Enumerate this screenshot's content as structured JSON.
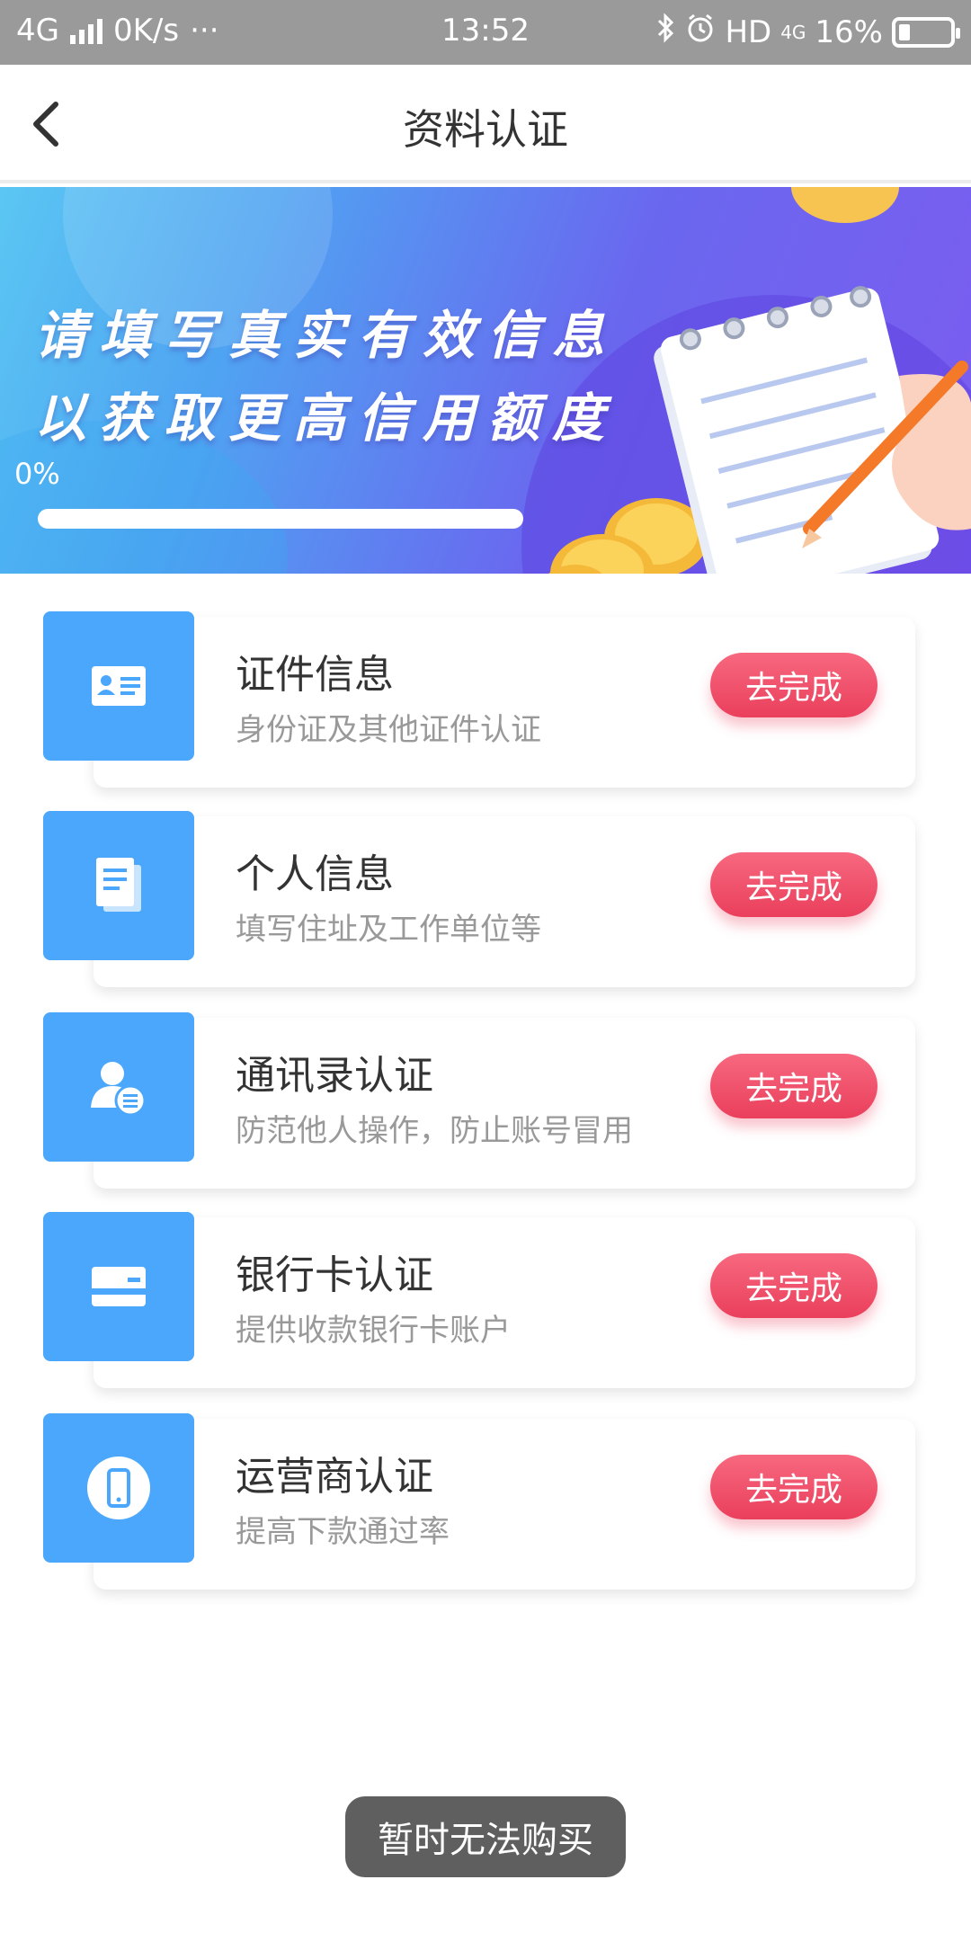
{
  "status_bar": {
    "network": "4G",
    "speed": "0K/s",
    "more": "···",
    "time": "13:52",
    "hd": "HD",
    "net2": "4G",
    "battery": "16%"
  },
  "nav": {
    "title": "资料认证"
  },
  "banner": {
    "line1": "请填写真实有效信息",
    "line2": "以获取更高信用额度",
    "progress_text": "0%",
    "progress": 0
  },
  "items": [
    {
      "title": "证件信息",
      "subtitle": "身份证及其他证件认证",
      "button": "去完成",
      "icon": "id-card-icon"
    },
    {
      "title": "个人信息",
      "subtitle": "填写住址及工作单位等",
      "button": "去完成",
      "icon": "document-icon"
    },
    {
      "title": "通讯录认证",
      "subtitle": "防范他人操作，防止账号冒用",
      "button": "去完成",
      "icon": "contact-icon"
    },
    {
      "title": "银行卡认证",
      "subtitle": "提供收款银行卡账户",
      "button": "去完成",
      "icon": "bank-card-icon"
    },
    {
      "title": "运营商认证",
      "subtitle": "提高下款通过率",
      "button": "去完成",
      "icon": "phone-icon"
    }
  ],
  "toast": {
    "text": "暂时无法购买"
  },
  "colors": {
    "accent_blue": "#4aa7fb",
    "button_red": "#ea3f5c"
  }
}
